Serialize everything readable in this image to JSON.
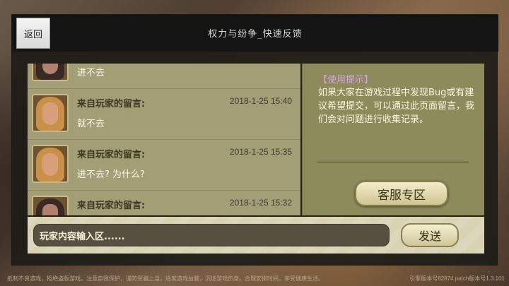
{
  "header": {
    "back_label": "返回",
    "title": "权力与纷争_快速反馈"
  },
  "messages": [
    {
      "sender": "",
      "time": "",
      "content": "进不去",
      "avatar": "dark-hair-hero-avatar"
    },
    {
      "sender": "来自玩家的留言:",
      "time": "2018-1-25 15:40",
      "content": "就不去",
      "avatar": "blond-hero-avatar"
    },
    {
      "sender": "来自玩家的留言:",
      "time": "2018-1-25 15:35",
      "content": "进不去? 为什么?",
      "avatar": "blond-hero-avatar"
    },
    {
      "sender": "来自玩家的留言:",
      "time": "2018-1-25 15:32",
      "content": "",
      "avatar": "armored-hero-avatar"
    }
  ],
  "tips": {
    "title": "【使用提示】",
    "text": "如果大家在游戏过程中发现Bug或有建议希望提交，可以通过此页面留言，我们会对问题进行收集记录。",
    "service_button": "客服专区"
  },
  "input": {
    "placeholder": "玩家内容输入区......",
    "send_label": "发送"
  },
  "footer": {
    "notice": "抵制不良游戏，拒绝盗版游戏。注意自我保护，谨防受骗上当。适度游戏益脑，沉迷游戏伤身。合理安排时间，享受健康生活。",
    "version": "引擎版本号82874 patch版本号1.3.101"
  },
  "colors": {
    "panel": "#a49e76",
    "tips_panel": "#8d8a5c",
    "tips_title": "#d8a4e8",
    "header": "#141414"
  }
}
